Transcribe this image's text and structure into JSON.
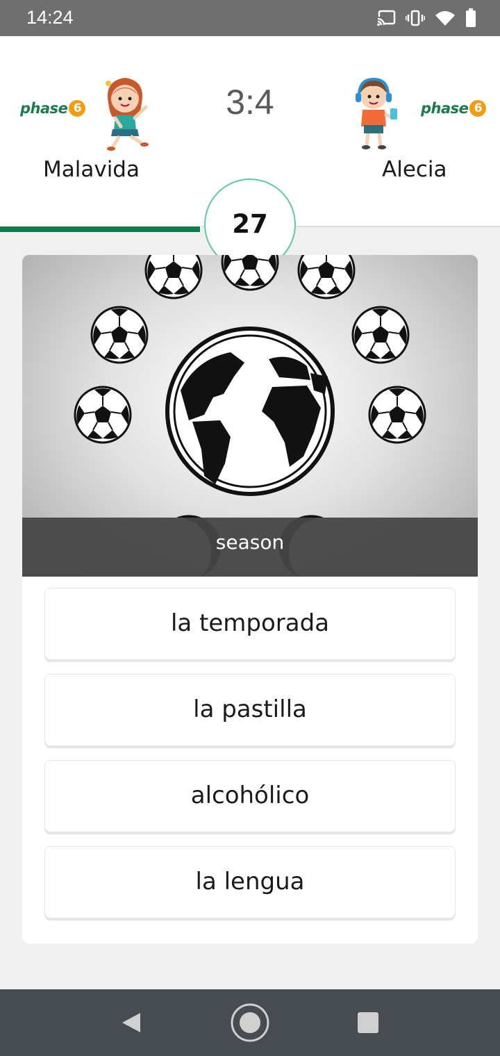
{
  "status_bar": {
    "time": "14:24",
    "icons": [
      "cast-icon",
      "vibrate-icon",
      "wifi-icon",
      "battery-icon"
    ]
  },
  "header": {
    "logo_text": "phase",
    "logo_digit": "6",
    "score": "3:4",
    "player_left": "Malavida",
    "player_right": "Alecia",
    "timer": "27",
    "round_progress": 0.4
  },
  "question": {
    "caption": "season",
    "image": "globe-with-soccer-balls-image"
  },
  "answers": [
    "la temporada",
    "la pastilla",
    "alcohólico",
    "la lengua"
  ],
  "nav": {
    "icons": [
      "back-icon",
      "home-icon",
      "recents-icon"
    ]
  },
  "colors": {
    "brand_green": "#107a4f",
    "brand_orange": "#f39c12",
    "timer_ring": "#5ccaa4"
  }
}
